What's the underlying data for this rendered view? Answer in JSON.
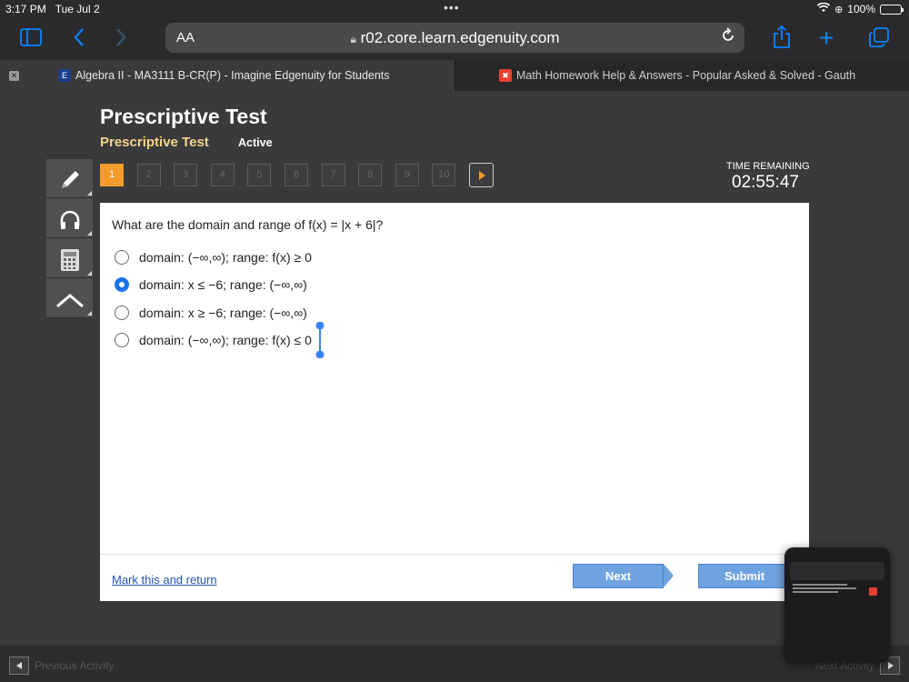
{
  "status_bar": {
    "time": "3:17 PM",
    "date": "Tue Jul 2",
    "battery": "100%"
  },
  "browser": {
    "text_size_label": "AA",
    "url": "r02.core.learn.edgenuity.com"
  },
  "tabs": [
    {
      "title": "Algebra II - MA3111 B-CR(P) - Imagine Edgenuity for Students",
      "favicon": "E"
    },
    {
      "title": "Math Homework Help & Answers - Popular Asked & Solved - Gauth",
      "favicon": "✖"
    }
  ],
  "page": {
    "title": "Prescriptive Test",
    "subtitle": "Prescriptive Test",
    "status": "Active"
  },
  "tools": [
    {
      "name": "pencil",
      "glyph": "✎"
    },
    {
      "name": "headphones",
      "glyph": "∩"
    },
    {
      "name": "calculator",
      "glyph": "▦"
    },
    {
      "name": "hat",
      "glyph": "⌃"
    }
  ],
  "question_numbers": [
    "1",
    "2",
    "3",
    "4",
    "5",
    "6",
    "7",
    "8",
    "9",
    "10"
  ],
  "timer": {
    "label": "TIME REMAINING",
    "value": "02:55:47"
  },
  "question": {
    "text": "What are the domain and range of f(x) = |x + 6|?",
    "choices": [
      {
        "text": "domain: (−∞,∞); range: f(x) ≥ 0",
        "selected": false
      },
      {
        "text": "domain: x ≤ −6; range: (−∞,∞)",
        "selected": true
      },
      {
        "text": "domain: x ≥ −6; range: (−∞,∞)",
        "selected": false
      },
      {
        "text": "domain: (−∞,∞); range: f(x) ≤ 0",
        "selected": false
      }
    ]
  },
  "footer": {
    "mark_link": "Mark this and return",
    "next_label": "Next",
    "submit_label": "Submit"
  },
  "bottom": {
    "previous_label": "Previous Activity",
    "next_label": "Next Activity"
  },
  "colors": {
    "accent_orange": "#f39c2b",
    "link_blue": "#2255aa",
    "button_blue": "#6fa3e0",
    "radio_blue": "#1a73e8",
    "safari_blue": "#0a84ff"
  }
}
